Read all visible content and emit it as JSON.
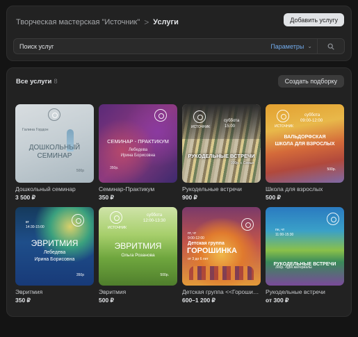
{
  "header": {
    "breadcrumb_parent": "Творческая мастерская \"Источник\"",
    "breadcrumb_separator": ">",
    "breadcrumb_current": "Услуги",
    "add_service_button": "Добавить услугу"
  },
  "search": {
    "placeholder": "Поиск услуг",
    "params_label": "Параметры"
  },
  "section": {
    "title": "Все услуги",
    "count": "8",
    "create_collection_button": "Создать подборку"
  },
  "cards": [
    {
      "title": "Дошкольный семинар",
      "price": "3 500 ₽",
      "thumb": {
        "line1": "ДОШКОЛЬНЫЙ",
        "line2": "СЕМИНАР",
        "author": "Галина Гордон",
        "price": "500р"
      }
    },
    {
      "title": "Семинар-Практикум",
      "price": "350 ₽",
      "thumb": {
        "line1": "СЕМИНАР - ПРАКТИКУМ",
        "name1": "Лебедева",
        "name2": "Ирина Борисовна",
        "price": "350р."
      }
    },
    {
      "title": "Рукодельные встречи",
      "price": "900 ₽",
      "thumb": {
        "logo_text": "ИСТОЧНИК",
        "day": "суббота",
        "time": "15:00",
        "line1": "РУКОДЕЛЬНЫЕ ВСТРЕЧИ",
        "price": "900р. с Семьи"
      }
    },
    {
      "title": "Школа для взрослых",
      "price": "500 ₽",
      "thumb": {
        "logo_text": "ИСТОЧНИК",
        "day": "суббота",
        "time": "09:00-12:00",
        "line1": "ВАЛЬДОРФСКАЯ",
        "line2": "ШКОЛА ДЛЯ ВЗРОСЛЫХ",
        "price": "500р."
      }
    },
    {
      "title": "Эвритмия",
      "price": "350 ₽",
      "thumb": {
        "day": "вт",
        "time": "14:30-15:00",
        "line1": "ЭВРИТМИЯ",
        "name1": "Лебедева",
        "name2": "Ирина Борисовна",
        "price": "350р"
      }
    },
    {
      "title": "Эвритмия",
      "price": "500 ₽",
      "thumb": {
        "logo_text": "ИСТОЧНИК",
        "day": "суббота",
        "time": "12:00-13:30",
        "line1": "ЭВРИТМИЯ",
        "name1": "Ольга Розанова",
        "price": "500р."
      }
    },
    {
      "title": "Детская группа <<Горошинка>>",
      "price": "600–1 200 ₽",
      "thumb": {
        "day": "пт, чт",
        "time": "9:00-12:00",
        "line1": "Детская группа",
        "line2": "ГОРОШИНКА",
        "sub": "от 3 до 6 лет"
      }
    },
    {
      "title": "Рукодельные встречи",
      "price": "от 300 ₽",
      "thumb": {
        "day": "пн, чт",
        "time": "11:00-15:30",
        "line1": "РУКОДЕЛЬНЫЕ ВСТРЕЧИ",
        "price": "300р. +доп.материалы"
      }
    }
  ],
  "icons": {
    "search": "search-icon",
    "chevron": "chevron-down-icon",
    "logo": "istochnik-logo-icon"
  },
  "colors": {
    "link": "#71aaeb",
    "background": "#141414",
    "panel": "#222222"
  }
}
